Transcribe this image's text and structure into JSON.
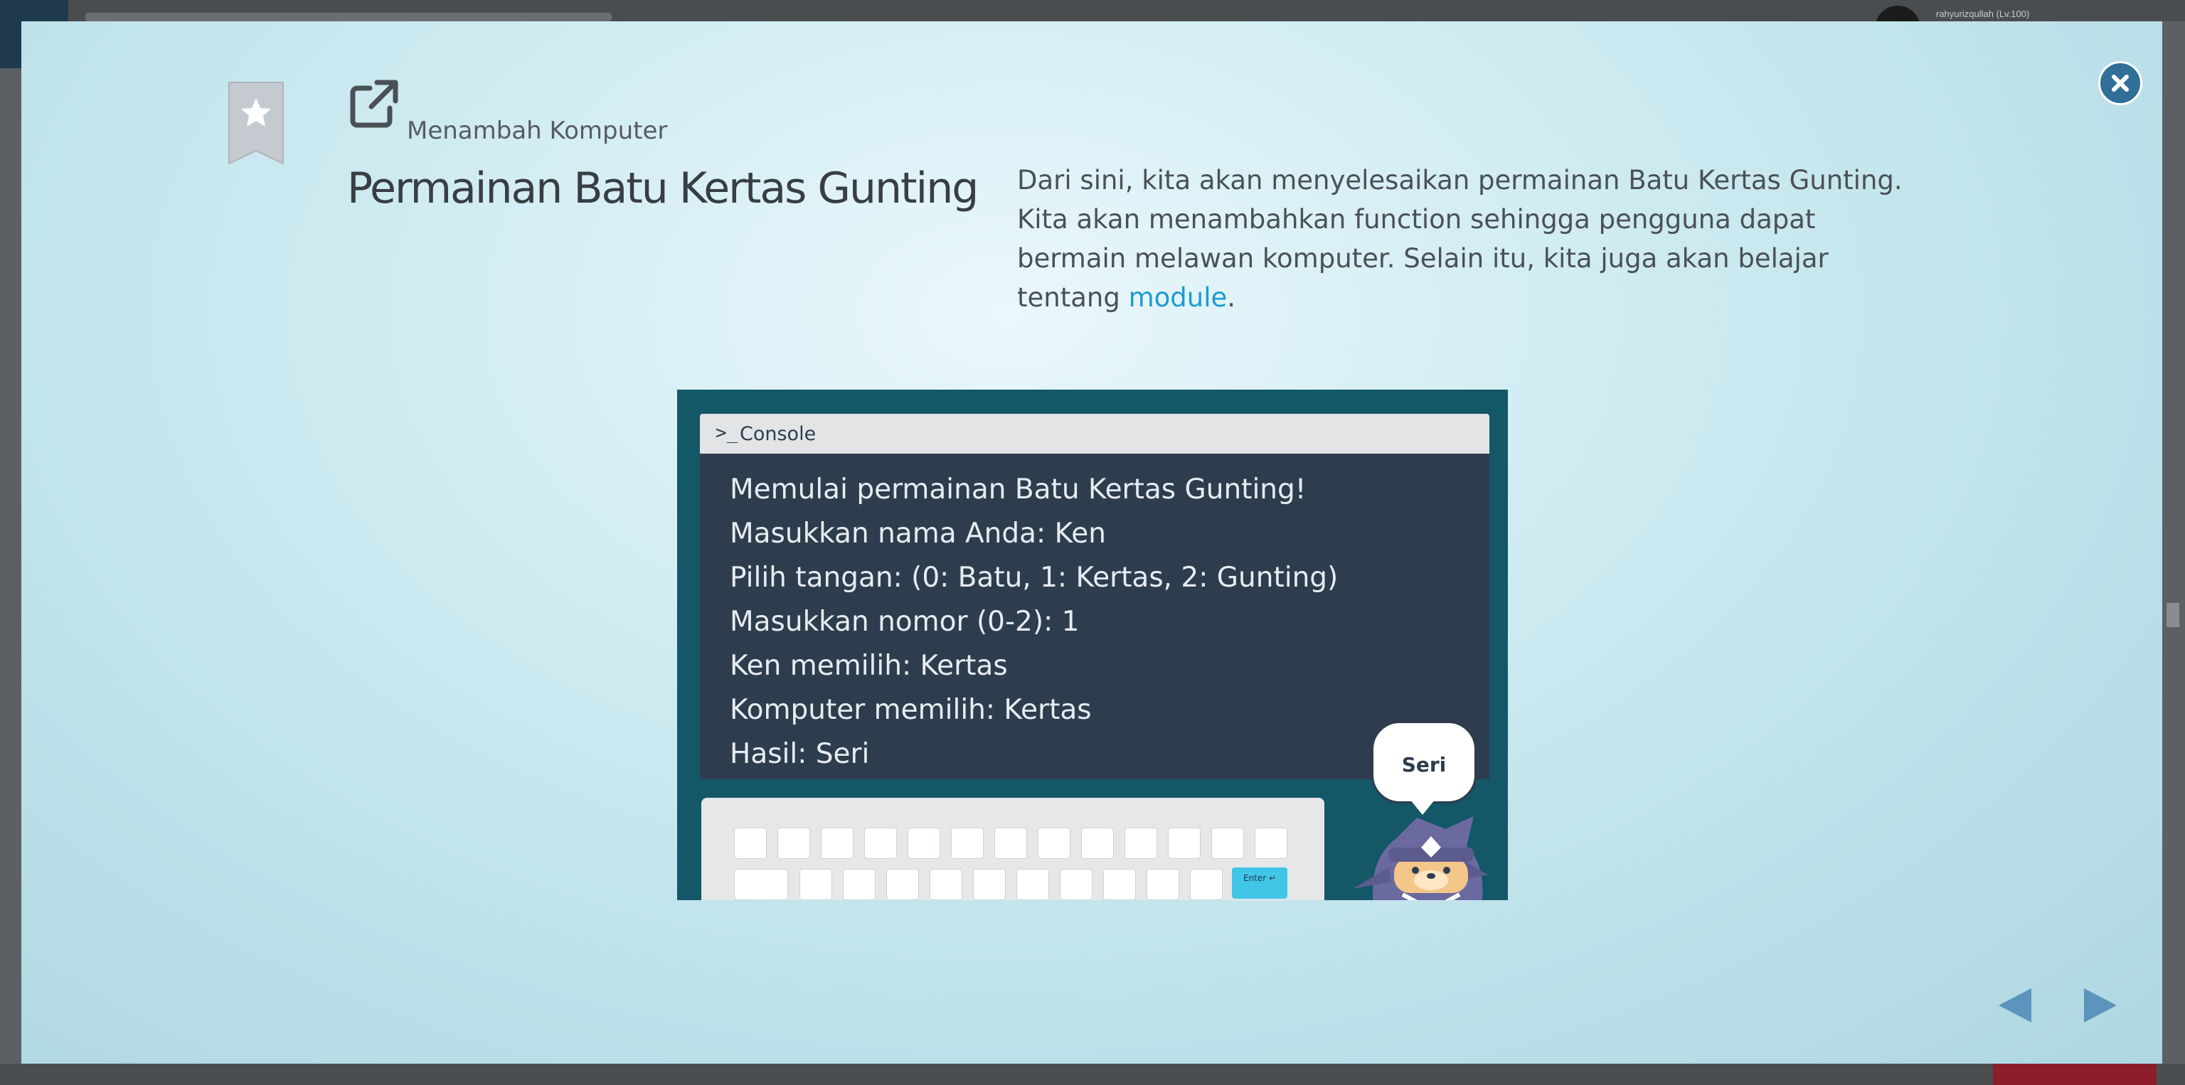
{
  "background": {
    "user_label": "rahyurizqullah (Lv.100)"
  },
  "modal": {
    "close_icon": "close-icon",
    "bookmark_icon": "bookmark-star-icon",
    "section_icon": "external-link-icon",
    "section_label": "Menambah Komputer",
    "title": "Permainan Batu Kertas Gunting",
    "description": "Dari sini, kita akan menyelesaikan permainan Batu Kertas Gunting. Kita akan menambahkan function sehingga pengguna dapat bermain melawan komputer. Selain itu, kita juga akan belajar tentang ",
    "description_link": "module",
    "description_end": "."
  },
  "illustration": {
    "console_title": "Console",
    "console_lines": [
      "Memulai permainan  Batu Kertas Gunting!",
      "Masukkan nama Anda: Ken",
      "Pilih tangan: (0: Batu, 1: Kertas, 2: Gunting)",
      "Masukkan nomor (0-2): 1",
      "Ken memilih: Kertas",
      "Komputer memilih: Kertas",
      "Hasil: Seri"
    ],
    "enter_key": "Enter ↵",
    "speech_bubble": "Seri"
  },
  "navigation": {
    "prev_icon": "triangle-left-icon",
    "next_icon": "triangle-right-icon"
  },
  "colors": {
    "accent": "#2f6f98",
    "link": "#1d9bd1",
    "console_bg": "#2d3d4e",
    "illustration_bg": "#145767"
  }
}
